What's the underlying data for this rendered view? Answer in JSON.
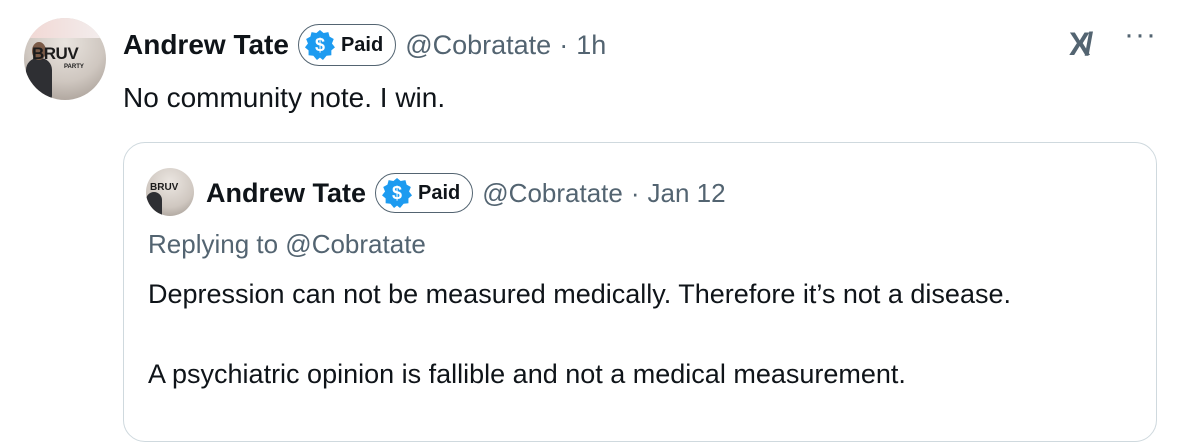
{
  "tweet": {
    "author": {
      "name": "Andrew Tate",
      "badge_label": "Paid",
      "badge_icon": "dollar-badge-icon",
      "handle": "@Cobratate",
      "time": "1h"
    },
    "avatar_text": {
      "top": "BRUV",
      "sub": "PARTY"
    },
    "text": "No community note. I win.",
    "separator": "·",
    "actions": {
      "grok_icon": "xai-logo-icon",
      "more_label": "···"
    }
  },
  "quoted": {
    "author": {
      "name": "Andrew Tate",
      "badge_label": "Paid",
      "handle": "@Cobratate",
      "time": "Jan 12"
    },
    "avatar_text": {
      "top": "BRUV"
    },
    "replying_to": "Replying to @Cobratate",
    "paragraphs": [
      "Depression can not be measured medically. Therefore it’s not a disease.",
      "A psychiatric opinion is fallible and not a medical measurement."
    ]
  },
  "colors": {
    "text": "#0f1419",
    "secondary": "#536471",
    "accent": "#1d9bf0",
    "border": "#cfd9de"
  }
}
